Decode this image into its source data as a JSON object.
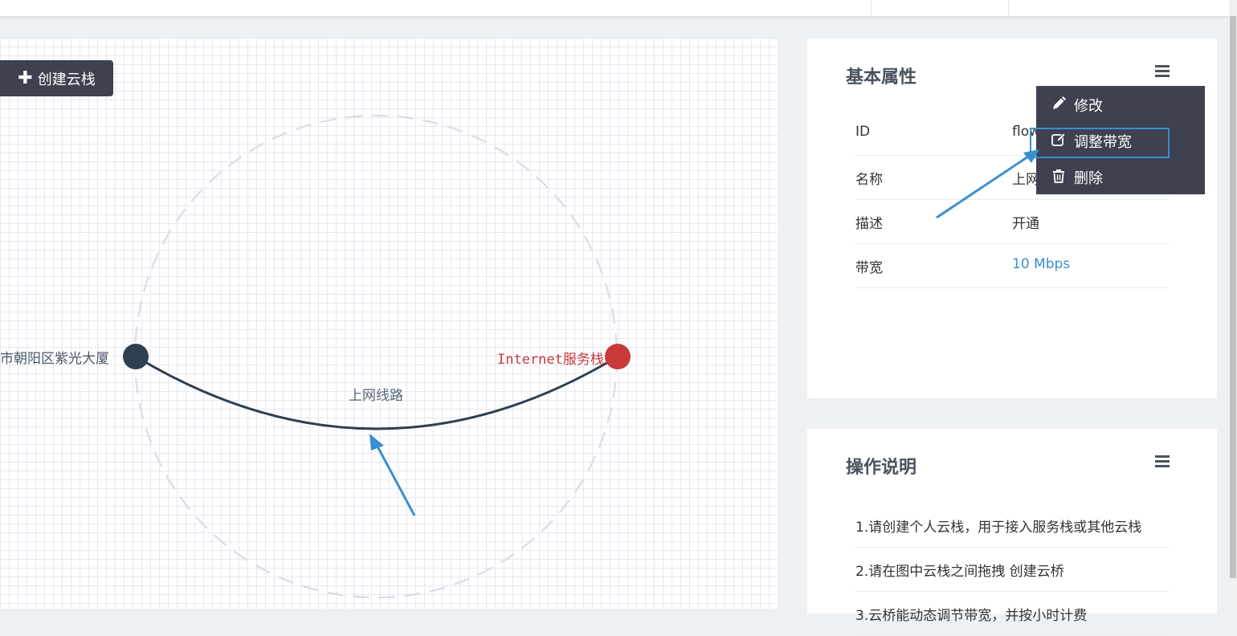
{
  "toolbar": {
    "create_label": "创建云栈"
  },
  "topology": {
    "left_node_label": "市朝阳区紫光大厦",
    "right_node_label": "Internet服务栈",
    "link_label": "上网线路",
    "left_node_color": "#2e3f4f",
    "right_node_color": "#c83a3a"
  },
  "props_panel": {
    "title": "基本属性",
    "rows": [
      {
        "key": "ID",
        "value": "flow"
      },
      {
        "key": "名称",
        "value": "上网"
      },
      {
        "key": "描述",
        "value": "开通"
      },
      {
        "key": "带宽",
        "value": "10 Mbps"
      }
    ]
  },
  "dropdown": {
    "items": [
      {
        "label": "修改",
        "icon": "pencil-icon"
      },
      {
        "label": "调整带宽",
        "icon": "edit-icon"
      },
      {
        "label": "删除",
        "icon": "trash-icon"
      }
    ]
  },
  "ops_panel": {
    "title": "操作说明",
    "items": [
      "1.请创建个人云栈，用于接入服务栈或其他云栈",
      "2.请在图中云栈之间拖拽 创建云桥",
      "3.云桥能动态调节带宽，并按小时计费"
    ]
  },
  "colors": {
    "accent": "#3a8fd0",
    "dark": "#3d4150"
  }
}
